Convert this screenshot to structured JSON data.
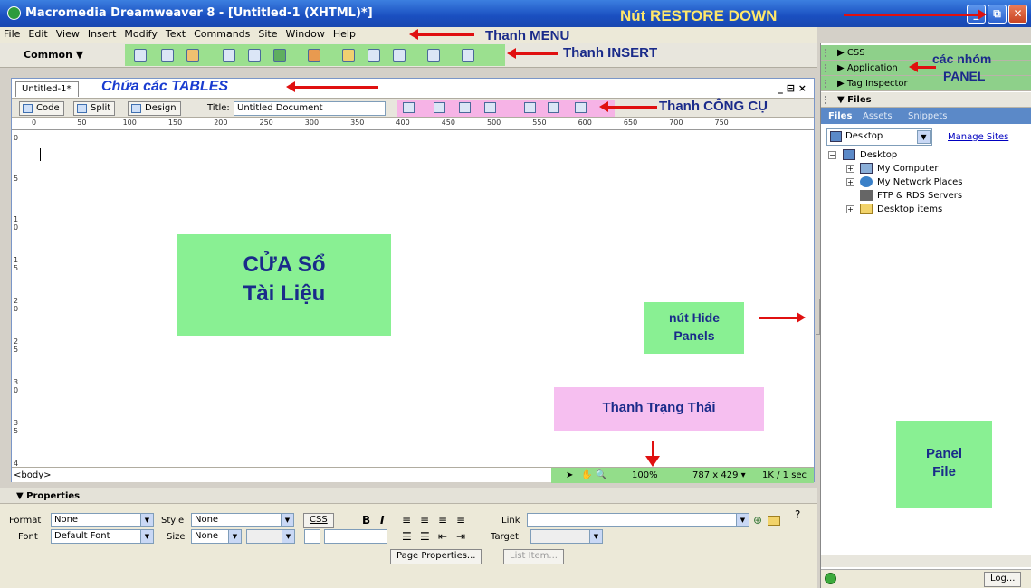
{
  "window": {
    "title": "Macromedia Dreamweaver 8 - [Untitled-1 (XHTML)*]",
    "controls": {
      "minimize": "_",
      "restore": "⧉",
      "close": "✕"
    }
  },
  "menu": [
    "File",
    "Edit",
    "View",
    "Insert",
    "Modify",
    "Text",
    "Commands",
    "Site",
    "Window",
    "Help"
  ],
  "insert_bar": {
    "category": "Common ▼"
  },
  "document": {
    "tab": "Untitled-1*",
    "window_controls": "_ ⊟ ×",
    "views": [
      "Code",
      "Split",
      "Design"
    ],
    "title_label": "Title:",
    "title_value": "Untitled Document",
    "ruler_marks": [
      "0",
      "50",
      "100",
      "150",
      "200",
      "250",
      "300",
      "350",
      "400",
      "450",
      "500",
      "550",
      "600",
      "650",
      "700",
      "750"
    ],
    "vruler_marks": [
      "0",
      "5",
      "1 0",
      "1 5",
      "2 0",
      "2 5",
      "3 0",
      "3 5",
      "4 0"
    ],
    "tag_selector": "<body>",
    "zoom": "100%",
    "window_size": "787 x 429 ▾",
    "download": "1K / 1 sec"
  },
  "panels": {
    "groups": [
      "▶ CSS",
      "▶ Application",
      "▶ Tag Inspector"
    ],
    "files_header": "▼ Files",
    "files_tabs": [
      "Files",
      "Assets",
      "Snippets"
    ],
    "site_select": "Desktop",
    "manage_sites": "Manage Sites",
    "tree": [
      "Desktop",
      "My Computer",
      "My Network Places",
      "FTP & RDS Servers",
      "Desktop items"
    ],
    "log_button": "Log..."
  },
  "properties": {
    "header": "▼ Properties",
    "format_label": "Format",
    "format_value": "None",
    "style_label": "Style",
    "style_value": "None",
    "css_button": "CSS",
    "bold": "B",
    "italic": "I",
    "link_label": "Link",
    "font_label": "Font",
    "font_value": "Default Font",
    "size_label": "Size",
    "size_value": "None",
    "target_label": "Target",
    "page_properties": "Page Properties...",
    "list_item": "List Item..."
  },
  "annotations": {
    "restore": "Nút RESTORE DOWN",
    "menu": "Thanh MENU",
    "insert": "Thanh INSERT",
    "tables": "Chứa các TABLES",
    "tools": "Thanh CÔNG CỤ",
    "panel_groups_1": "các nhóm",
    "panel_groups_2": "PANEL",
    "doc_window_1": "CỬA Sổ",
    "doc_window_2": "Tài Liệu",
    "hide_panels_1": "nút Hide",
    "hide_panels_2": "Panels",
    "status_bar": "Thanh Trạng Thái",
    "panel_file_1": "Panel",
    "panel_file_2": "File"
  },
  "colors": {
    "titlebar": "#1a4fc0",
    "highlight_green": "#89f093",
    "highlight_pink": "#f6b3e6",
    "arrow": "#e01010"
  }
}
